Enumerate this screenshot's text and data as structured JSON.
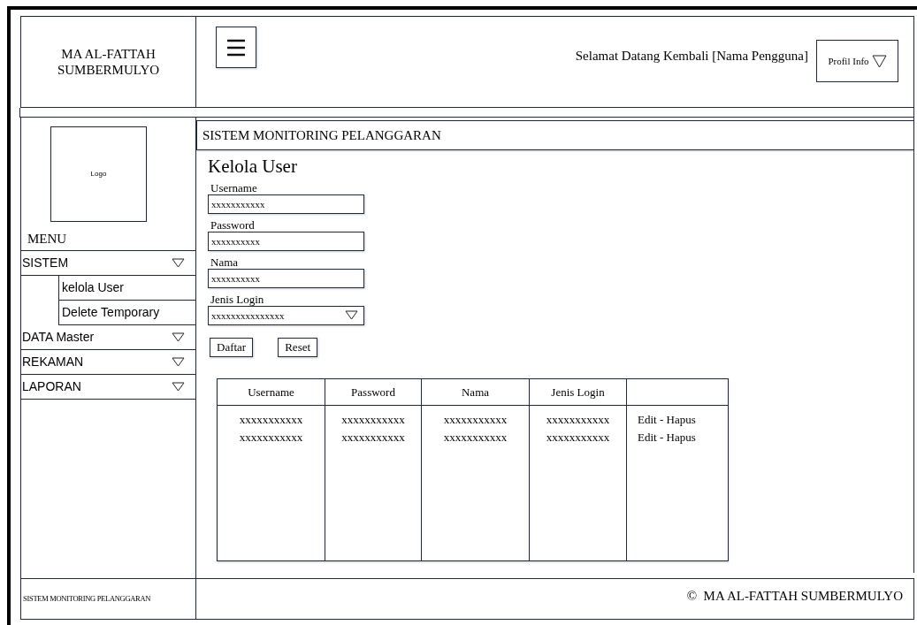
{
  "header": {
    "brand": [
      "MA AL-FATTAH",
      "SUMBERMULYO"
    ],
    "greeting": "Selamat Datang Kembali [Nama Pengguna]",
    "profile_button": "Profil Info"
  },
  "sidebar": {
    "logo": "Logo",
    "menu_title": "MENU",
    "items": [
      {
        "label": "SISTEM",
        "children": [
          {
            "label": "kelola User"
          },
          {
            "label": "Delete Temporary"
          }
        ]
      },
      {
        "label": "DATA Master"
      },
      {
        "label": "REKAMAN"
      },
      {
        "label": "LAPORAN"
      }
    ]
  },
  "title_bar": "SISTEM MONITORING PELANGGARAN",
  "form": {
    "heading": "Kelola User",
    "fields": [
      {
        "kind": "text",
        "label": "Username",
        "value": "xxxxxxxxxxx"
      },
      {
        "kind": "text",
        "label": "Password",
        "value": "xxxxxxxxxx"
      },
      {
        "kind": "text",
        "label": "Nama",
        "value": "xxxxxxxxxx"
      },
      {
        "kind": "select",
        "label": "Jenis Login",
        "value": "xxxxxxxxxxxxxxx"
      }
    ],
    "buttons": [
      "Daftar",
      "Reset"
    ]
  },
  "table": {
    "columns": [
      "Username",
      "Password",
      "Nama",
      "Jenis Login"
    ],
    "rows": [
      [
        "xxxxxxxxxxx",
        "xxxxxxxxxxx",
        "xxxxxxxxxxx",
        "xxxxxxxxxxx",
        "Edit - Hapus"
      ],
      [
        "xxxxxxxxxxx",
        "xxxxxxxxxxx",
        "xxxxxxxxxxx",
        "xxxxxxxxxxx",
        "Edit - Hapus"
      ]
    ]
  },
  "footer": {
    "left": "SISTEM MONITORING PELANGGARAN",
    "copyright": "©  MA AL-FATTAH SUMBERMULYO"
  }
}
